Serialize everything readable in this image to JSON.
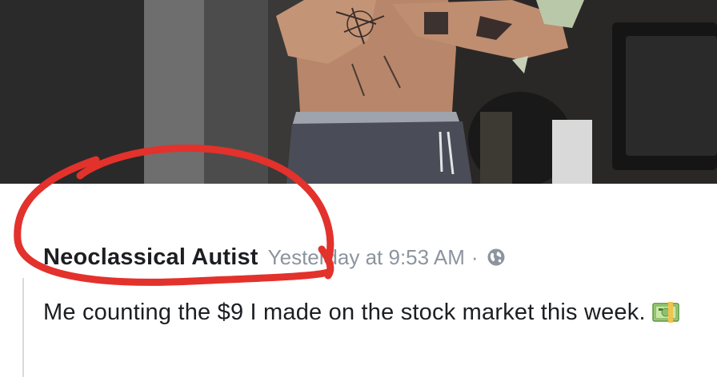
{
  "post": {
    "author": "Neoclassical Autist",
    "timestamp": "Yesterday at 9:53 AM",
    "separator": "·",
    "privacy_icon": "globe-icon",
    "text": "Me counting the $9 I made on the stock market this week.",
    "emoji": "money-with-wings-icon"
  },
  "colors": {
    "author": "#1c1e21",
    "meta": "#8d949e",
    "annotation": "#e3312c"
  }
}
